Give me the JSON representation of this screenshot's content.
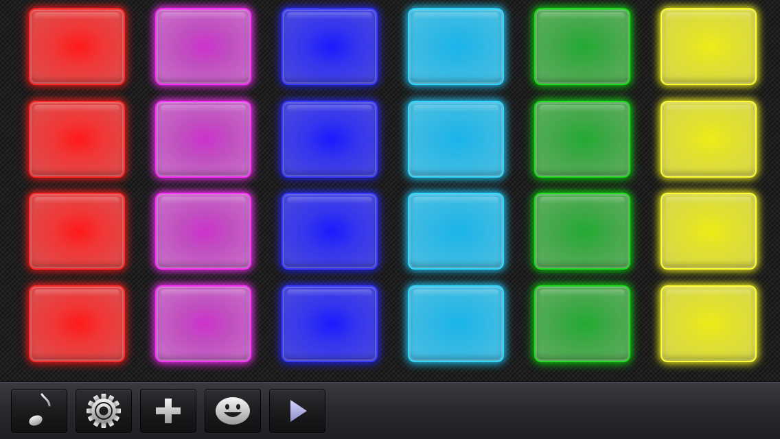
{
  "pad_grid": {
    "rows": 4,
    "columns": [
      {
        "color_name": "red",
        "core": "#ff1a1a",
        "mid": "#f03838",
        "outer": "#e04a4a",
        "edge": "#ff2a2a",
        "glow": "#ff2020"
      },
      {
        "color_name": "magenta",
        "core": "#cc33cc",
        "mid": "#c050c0",
        "outer": "#c66ac6",
        "edge": "#ff33ff",
        "glow": "#ff33ff"
      },
      {
        "color_name": "blue",
        "core": "#1a1aff",
        "mid": "#3535ee",
        "outer": "#4646e0",
        "edge": "#3a3aff",
        "glow": "#2a2aff"
      },
      {
        "color_name": "cyan",
        "core": "#1ab4ea",
        "mid": "#2fb8e4",
        "outer": "#46bde2",
        "edge": "#33d8ff",
        "glow": "#22ccff"
      },
      {
        "color_name": "green",
        "core": "#22aa33",
        "mid": "#40a848",
        "outer": "#58ac5a",
        "edge": "#22dd22",
        "glow": "#11dd11"
      },
      {
        "color_name": "yellow",
        "core": "#ecec18",
        "mid": "#e0e030",
        "outer": "#d8d848",
        "edge": "#ffff33",
        "glow": "#ffff22"
      }
    ]
  },
  "toolbar": {
    "buttons": [
      {
        "name": "music-button",
        "icon": "music-note-icon"
      },
      {
        "name": "settings-button",
        "icon": "gear-icon"
      },
      {
        "name": "add-button",
        "icon": "plus-icon"
      },
      {
        "name": "face-button",
        "icon": "smiley-icon"
      },
      {
        "name": "play-button",
        "icon": "play-icon"
      }
    ]
  }
}
